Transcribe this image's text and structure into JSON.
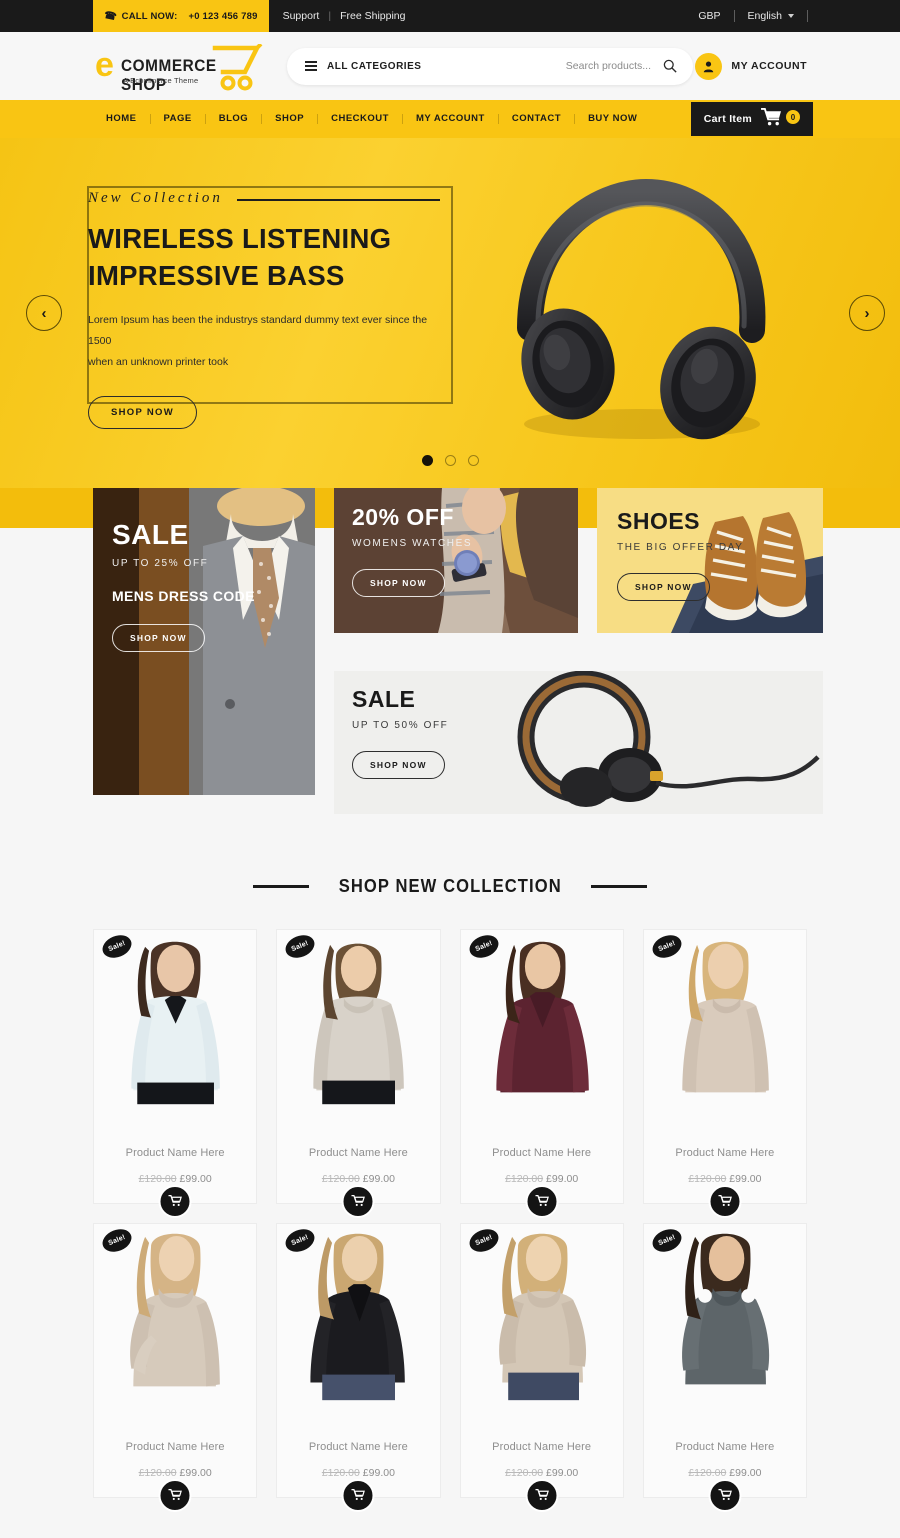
{
  "topbar": {
    "call_label": "CALL NOW:",
    "phone": "+0 123 456 789",
    "support": "Support",
    "free_shipping": "Free Shipping",
    "currency": "GBP",
    "language": "English"
  },
  "header": {
    "logo_e": "e",
    "logo_word": "COMMERCE SHOP",
    "logo_tagline": "A Ecommerce Theme",
    "all_categories": "ALL CATEGORIES",
    "search_placeholder": "Search products...",
    "search_value": "",
    "account_label": "MY ACCOUNT"
  },
  "nav": {
    "items": [
      {
        "label": "HOME"
      },
      {
        "label": "PAGE"
      },
      {
        "label": "BLOG"
      },
      {
        "label": "SHOP"
      },
      {
        "label": "CHECKOUT"
      },
      {
        "label": "MY ACCOUNT"
      },
      {
        "label": "CONTACT"
      },
      {
        "label": "BUY NOW"
      }
    ],
    "cart_label": "Cart Item",
    "cart_count": "0"
  },
  "hero": {
    "eyebrow": "New Collection",
    "title_line1": "WIRELESS LISTENING",
    "title_line2": "IMPRESSIVE BASS",
    "desc_line1": "Lorem Ipsum has been the industrys standard dummy text ever since the 1500",
    "desc_line2": "when an unknown printer took",
    "button": "SHOP NOW",
    "prev_icon": "chevron-left-icon",
    "next_icon": "chevron-right-icon",
    "active_slide": 1,
    "slide_count": 3
  },
  "promos": [
    {
      "id": "mens",
      "heading": "SALE",
      "sub": "UP TO 25% OFF",
      "heading2": "MENS DRESS CODE",
      "button": "SHOP NOW"
    },
    {
      "id": "watches",
      "heading": "20% OFF",
      "sub": "WOMENS WATCHES",
      "button": "SHOP NOW"
    },
    {
      "id": "shoes",
      "heading": "SHOES",
      "sub": "THE BIG OFFER DAY",
      "button": "SHOP NOW"
    },
    {
      "id": "headphone-sale",
      "heading": "SALE",
      "sub": "UP TO 50% OFF",
      "button": "SHOP NOW"
    }
  ],
  "shop": {
    "section_title": "SHOP NEW COLLECTION",
    "badge_label": "Sale!",
    "products": [
      {
        "name": "Product Name Here",
        "old_price": "£120.00",
        "price": "£99.00"
      },
      {
        "name": "Product Name Here",
        "old_price": "£120.00",
        "price": "£99.00"
      },
      {
        "name": "Product Name Here",
        "old_price": "£120.00",
        "price": "£99.00"
      },
      {
        "name": "Product Name Here",
        "old_price": "£120.00",
        "price": "£99.00"
      },
      {
        "name": "Product Name Here",
        "old_price": "£120.00",
        "price": "£99.00"
      },
      {
        "name": "Product Name Here",
        "old_price": "£120.00",
        "price": "£99.00"
      },
      {
        "name": "Product Name Here",
        "old_price": "£120.00",
        "price": "£99.00"
      },
      {
        "name": "Product Name Here",
        "old_price": "£120.00",
        "price": "£99.00"
      }
    ]
  },
  "colors": {
    "brand_yellow": "#f9c513",
    "dark": "#1a1a1a",
    "page_bg": "#f6f6f6"
  }
}
